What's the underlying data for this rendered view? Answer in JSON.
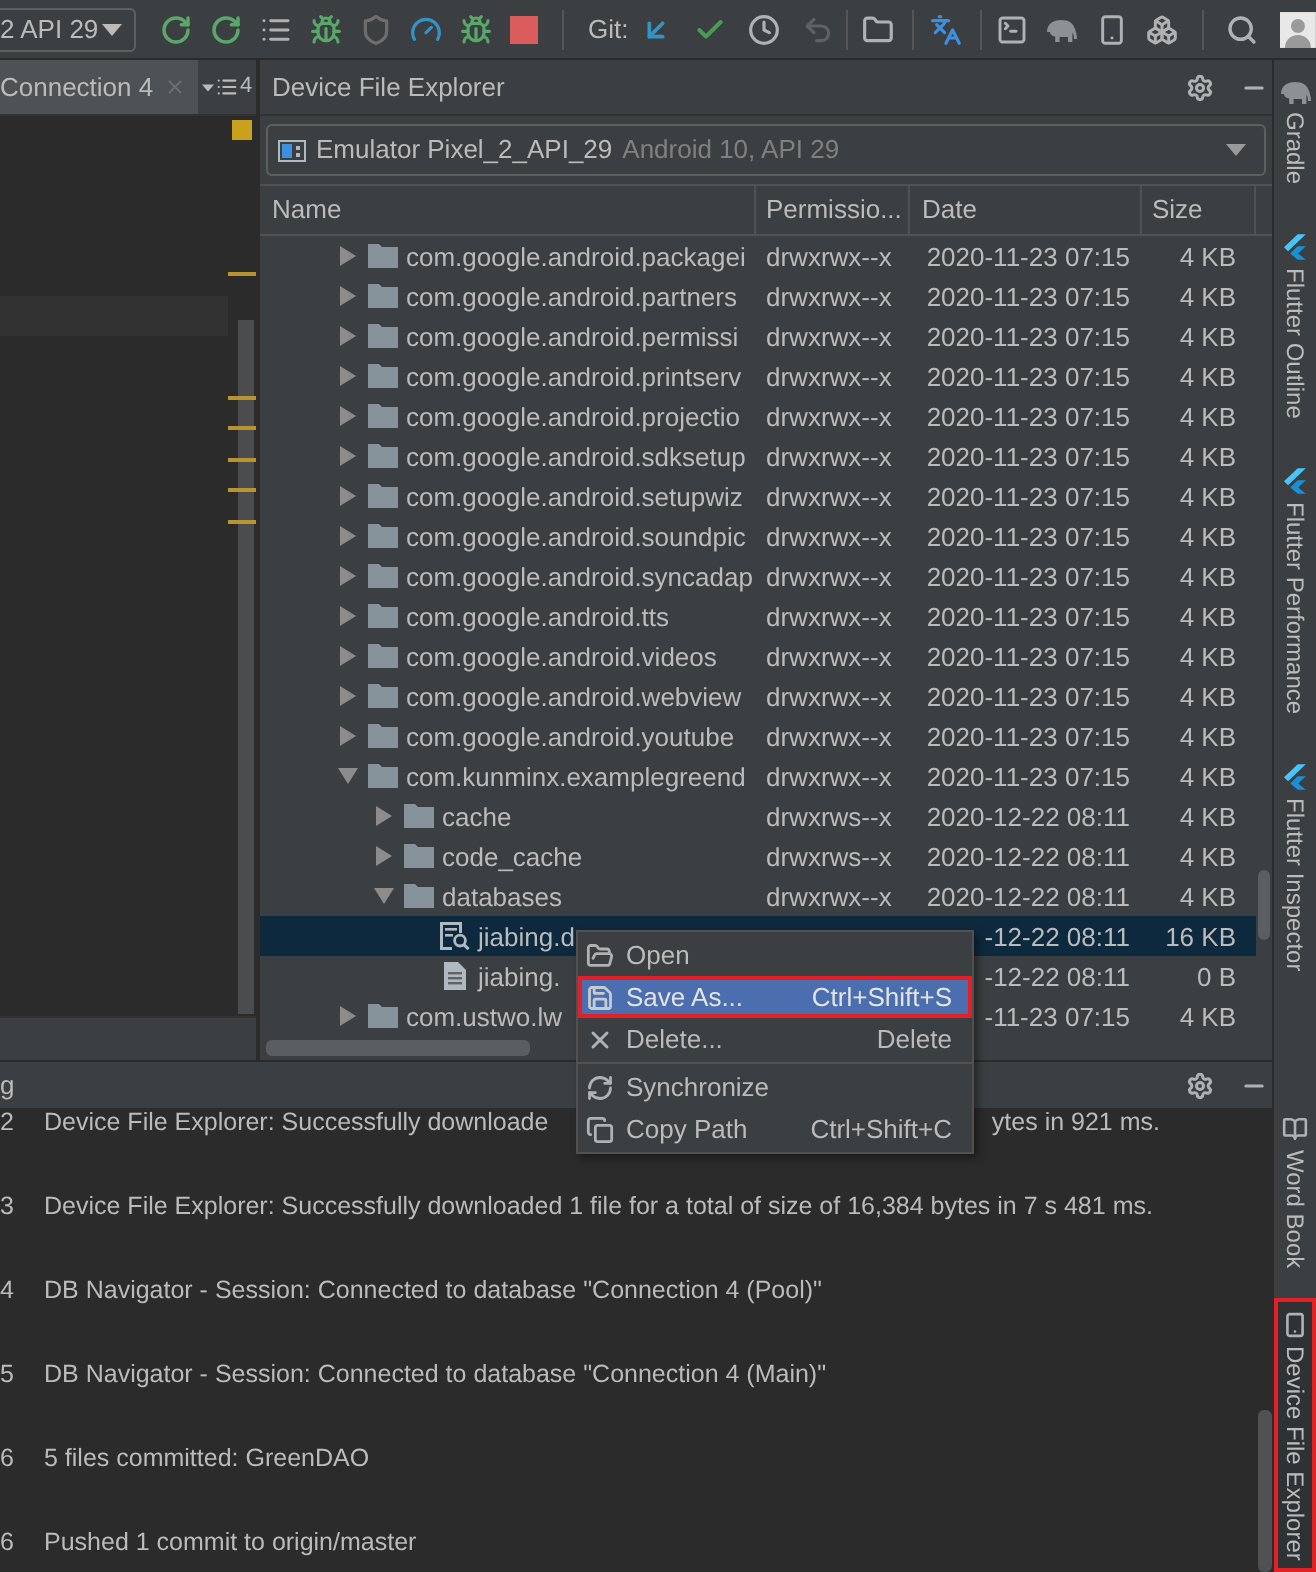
{
  "toolbar": {
    "run_config": "2 API 29",
    "git_label": "Git:"
  },
  "editor": {
    "tab_title": "Connection 4",
    "tab_count": "4"
  },
  "device_explorer": {
    "title": "Device File Explorer",
    "device": "Emulator Pixel_2_API_29",
    "device_detail": "Android 10, API 29",
    "columns": [
      "Name",
      "Permissio...",
      "Date",
      "Size"
    ],
    "rows": [
      {
        "name": "com.google.android.packagei",
        "kind": "folder",
        "expanded": false,
        "selected": false,
        "permissions": "drwxrwx--x",
        "date": "2020-11-23 07:15",
        "size": "4 KB"
      },
      {
        "name": "com.google.android.partners",
        "kind": "folder",
        "expanded": false,
        "selected": false,
        "permissions": "drwxrwx--x",
        "date": "2020-11-23 07:15",
        "size": "4 KB"
      },
      {
        "name": "com.google.android.permissi",
        "kind": "folder",
        "expanded": false,
        "selected": false,
        "permissions": "drwxrwx--x",
        "date": "2020-11-23 07:15",
        "size": "4 KB"
      },
      {
        "name": "com.google.android.printserv",
        "kind": "folder",
        "expanded": false,
        "selected": false,
        "permissions": "drwxrwx--x",
        "date": "2020-11-23 07:15",
        "size": "4 KB"
      },
      {
        "name": "com.google.android.projectio",
        "kind": "folder",
        "expanded": false,
        "selected": false,
        "permissions": "drwxrwx--x",
        "date": "2020-11-23 07:15",
        "size": "4 KB"
      },
      {
        "name": "com.google.android.sdksetup",
        "kind": "folder",
        "expanded": false,
        "selected": false,
        "permissions": "drwxrwx--x",
        "date": "2020-11-23 07:15",
        "size": "4 KB"
      },
      {
        "name": "com.google.android.setupwiz",
        "kind": "folder",
        "expanded": false,
        "selected": false,
        "permissions": "drwxrwx--x",
        "date": "2020-11-23 07:15",
        "size": "4 KB"
      },
      {
        "name": "com.google.android.soundpic",
        "kind": "folder",
        "expanded": false,
        "selected": false,
        "permissions": "drwxrwx--x",
        "date": "2020-11-23 07:15",
        "size": "4 KB"
      },
      {
        "name": "com.google.android.syncadap",
        "kind": "folder",
        "expanded": false,
        "selected": false,
        "permissions": "drwxrwx--x",
        "date": "2020-11-23 07:15",
        "size": "4 KB"
      },
      {
        "name": "com.google.android.tts",
        "kind": "folder",
        "expanded": false,
        "selected": false,
        "permissions": "drwxrwx--x",
        "date": "2020-11-23 07:15",
        "size": "4 KB"
      },
      {
        "name": "com.google.android.videos",
        "kind": "folder",
        "expanded": false,
        "selected": false,
        "permissions": "drwxrwx--x",
        "date": "2020-11-23 07:15",
        "size": "4 KB"
      },
      {
        "name": "com.google.android.webview",
        "kind": "folder",
        "expanded": false,
        "selected": false,
        "permissions": "drwxrwx--x",
        "date": "2020-11-23 07:15",
        "size": "4 KB"
      },
      {
        "name": "com.google.android.youtube",
        "kind": "folder",
        "expanded": false,
        "selected": false,
        "permissions": "drwxrwx--x",
        "date": "2020-11-23 07:15",
        "size": "4 KB"
      },
      {
        "name": "com.kunminx.examplegreend",
        "kind": "folder",
        "expanded": true,
        "selected": false,
        "permissions": "drwxrwx--x",
        "date": "2020-11-23 07:15",
        "size": "4 KB",
        "children": [
          {
            "name": "cache",
            "kind": "folder",
            "expanded": false,
            "selected": false,
            "permissions": "drwxrws--x",
            "date": "2020-12-22 08:11",
            "size": "4 KB"
          },
          {
            "name": "code_cache",
            "kind": "folder",
            "expanded": false,
            "selected": false,
            "permissions": "drwxrws--x",
            "date": "2020-12-22 08:11",
            "size": "4 KB"
          },
          {
            "name": "databases",
            "kind": "folder",
            "expanded": true,
            "selected": false,
            "permissions": "drwxrwx--x",
            "date": "2020-12-22 08:11",
            "size": "4 KB",
            "children": [
              {
                "name": "jiabing.d",
                "kind": "db",
                "selected": true,
                "date": "-12-22 08:11",
                "size": "16 KB"
              },
              {
                "name": "jiabing.",
                "kind": "file",
                "selected": false,
                "date": "-12-22 08:11",
                "size": "0 B"
              }
            ]
          }
        ]
      },
      {
        "name": "com.ustwo.lw",
        "kind": "folder",
        "expanded": false,
        "selected": false,
        "date": "-11-23 07:15",
        "size": "4 KB"
      }
    ]
  },
  "context_menu": {
    "groups": [
      [
        {
          "label": "Open",
          "selected": false,
          "highlighted": false
        },
        {
          "label": "Save As...",
          "shortcut": "Ctrl+Shift+S",
          "selected": true,
          "highlighted": true
        },
        {
          "label": "Delete...",
          "shortcut": "Delete",
          "selected": false,
          "highlighted": false
        }
      ],
      [
        {
          "label": "Synchronize",
          "selected": false,
          "highlighted": false
        },
        {
          "label": "Copy Path",
          "shortcut": "Ctrl+Shift+C",
          "selected": false,
          "highlighted": false
        }
      ]
    ]
  },
  "log_panel": {
    "title": "g",
    "lines": [
      {
        "time": "2",
        "parts": [
          "Device File Explorer: Successfully downloade",
          "ytes in 921 ms."
        ]
      },
      {
        "time": "3",
        "parts": [
          "Device File Explorer: Successfully downloaded 1 file for a total of size of 16,384 bytes in 7 s 481 ms."
        ]
      },
      {
        "time": "4",
        "parts": [
          "DB Navigator - Session: Connected to database \"Connection 4 (Pool)\""
        ]
      },
      {
        "time": "5",
        "parts": [
          "DB Navigator - Session: Connected to database \"Connection 4 (Main)\""
        ]
      },
      {
        "time": "6",
        "parts": [
          "5 files committed: GreenDAO"
        ]
      },
      {
        "time": "6",
        "parts": [
          "Pushed 1 commit to origin/master"
        ]
      }
    ]
  },
  "right_toolbar": {
    "top": [
      {
        "label": "Gradle",
        "selected": false,
        "highlighted": false
      },
      {
        "label": "Flutter Outline",
        "selected": false,
        "highlighted": false
      },
      {
        "label": "Flutter Performance",
        "selected": false,
        "highlighted": false
      },
      {
        "label": "Flutter Inspector",
        "selected": false,
        "highlighted": false
      }
    ],
    "bottom": [
      {
        "label": "Word Book",
        "selected": false,
        "highlighted": false
      },
      {
        "label": "Device File Explorer",
        "selected": true,
        "highlighted": true
      }
    ]
  }
}
